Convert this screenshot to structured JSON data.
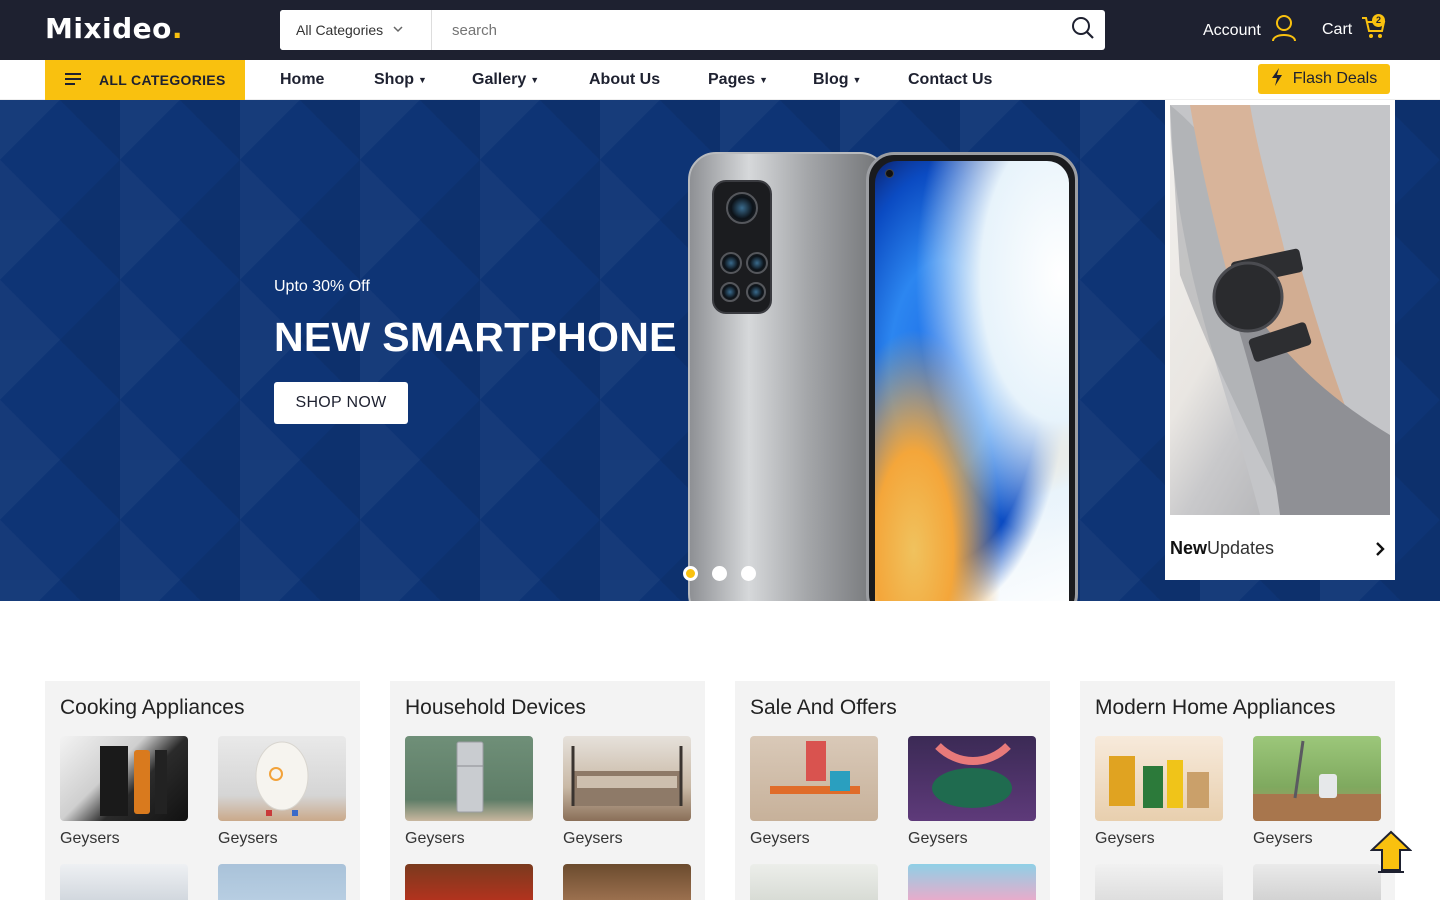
{
  "header": {
    "logo_text": "Mixideo",
    "logo_dot": ".",
    "search_category": "All Categories",
    "search_placeholder": "search",
    "account_label": "Account",
    "cart_label": "Cart",
    "cart_count": "2"
  },
  "nav": {
    "all_categories": "ALL CATEGORIES",
    "items": [
      "Home",
      "Shop",
      "Gallery",
      "About Us",
      "Pages",
      "Blog",
      "Contact Us"
    ],
    "flash_deals": "Flash Deals"
  },
  "hero": {
    "discount": "Upto 30% Off",
    "title": "NEW SMARTPHONE",
    "cta": "SHOP NOW",
    "slides": 3,
    "active_slide": 1
  },
  "side_card": {
    "caption_bold": "New",
    "caption_rest": "Updates"
  },
  "panels": [
    {
      "title": "Cooking Appliances",
      "items": [
        "Geysers",
        "Geysers"
      ]
    },
    {
      "title": "Household Devices",
      "items": [
        "Geysers",
        "Geysers"
      ]
    },
    {
      "title": "Sale And Offers",
      "items": [
        "Geysers",
        "Geysers"
      ]
    },
    {
      "title": "Modern Home Appliances",
      "items": [
        "Geysers",
        "Geysers"
      ]
    }
  ],
  "colors": {
    "header_bg": "#1e2130",
    "accent": "#f9c10f",
    "hero_bg": "#0e3475"
  }
}
